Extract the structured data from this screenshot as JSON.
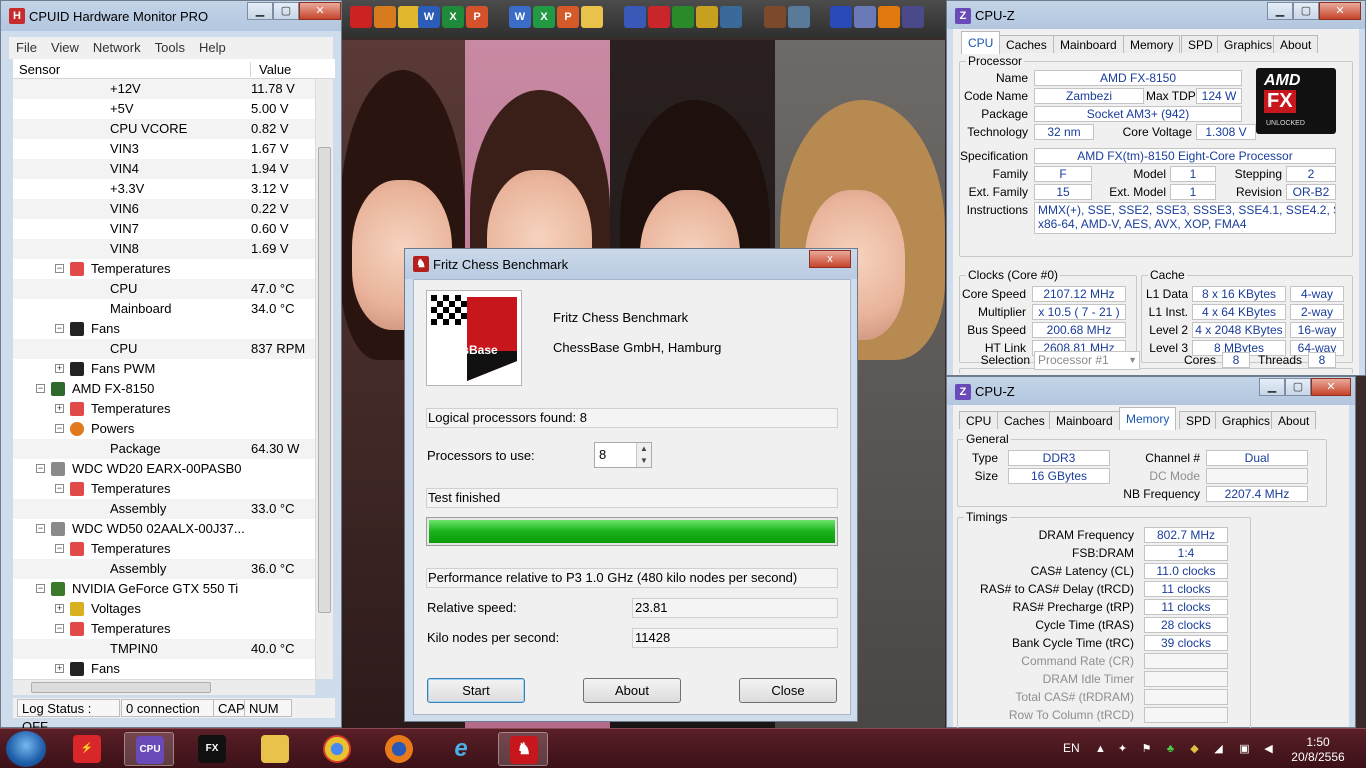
{
  "hwmonitor": {
    "title": "CPUID Hardware Monitor PRO",
    "menu": [
      "File",
      "View",
      "Network",
      "Tools",
      "Help"
    ],
    "columns": {
      "sensor": "Sensor",
      "value": "Value"
    },
    "rows": [
      {
        "label": "+12V",
        "value": "11.78 V"
      },
      {
        "label": "+5V",
        "value": "5.00 V"
      },
      {
        "label": "CPU VCORE",
        "value": "0.82 V"
      },
      {
        "label": "VIN3",
        "value": "1.67 V"
      },
      {
        "label": "VIN4",
        "value": "1.94 V"
      },
      {
        "label": "+3.3V",
        "value": "3.12 V"
      },
      {
        "label": "VIN6",
        "value": "0.22 V"
      },
      {
        "label": "VIN7",
        "value": "0.60 V"
      },
      {
        "label": "VIN8",
        "value": "1.69 V"
      },
      {
        "label": "Temperatures",
        "value": ""
      },
      {
        "label": "CPU",
        "value": "47.0 °C"
      },
      {
        "label": "Mainboard",
        "value": "34.0 °C"
      },
      {
        "label": "Fans",
        "value": ""
      },
      {
        "label": "CPU",
        "value": "837 RPM"
      },
      {
        "label": "Fans PWM",
        "value": ""
      },
      {
        "label": "AMD FX-8150",
        "value": ""
      },
      {
        "label": "Temperatures",
        "value": ""
      },
      {
        "label": "Powers",
        "value": ""
      },
      {
        "label": "Package",
        "value": "64.30 W"
      },
      {
        "label": "WDC WD20 EARX-00PASB0",
        "value": ""
      },
      {
        "label": "Temperatures",
        "value": ""
      },
      {
        "label": "Assembly",
        "value": "33.0 °C"
      },
      {
        "label": "WDC WD50 02AALX-00J37...",
        "value": ""
      },
      {
        "label": "Temperatures",
        "value": ""
      },
      {
        "label": "Assembly",
        "value": "36.0 °C"
      },
      {
        "label": "NVIDIA GeForce GTX 550 Ti",
        "value": ""
      },
      {
        "label": "Voltages",
        "value": ""
      },
      {
        "label": "Temperatures",
        "value": ""
      },
      {
        "label": "TMPIN0",
        "value": "40.0 °C"
      },
      {
        "label": "Fans",
        "value": ""
      }
    ],
    "status": {
      "log": "Log Status : OFF",
      "connection": "0 connection",
      "cap": "CAP",
      "num": "NUM"
    }
  },
  "fritz": {
    "title": "Fritz Chess Benchmark",
    "logo_text": "ChessBase",
    "app_name": "Fritz Chess Benchmark",
    "company": "ChessBase GmbH, Hamburg",
    "logical_processors": "Logical processors found: 8",
    "processors_label": "Processors to use:",
    "processors_value": "8",
    "status": "Test finished",
    "progress_percent": 100,
    "performance_note": "Performance relative to P3 1.0 GHz (480 kilo nodes per second)",
    "relative_speed_label": "Relative speed:",
    "relative_speed_value": "23.81",
    "knps_label": "Kilo nodes per second:",
    "knps_value": "11428",
    "buttons": {
      "start": "Start",
      "about": "About",
      "close": "Close"
    },
    "close_glyph": "x"
  },
  "cpuz_cpu": {
    "title": "CPU-Z",
    "tabs": [
      "CPU",
      "Caches",
      "Mainboard",
      "Memory",
      "SPD",
      "Graphics",
      "About"
    ],
    "processor_group": "Processor",
    "logo": {
      "brand": "AMD",
      "line": "FX",
      "tag": "UNLOCKED"
    },
    "name_label": "Name",
    "name": "AMD FX-8150",
    "codename_label": "Code Name",
    "codename": "Zambezi",
    "maxtdp_label": "Max TDP",
    "maxtdp": "124 W",
    "package_label": "Package",
    "package": "Socket AM3+ (942)",
    "technology_label": "Technology",
    "technology": "32 nm",
    "corevoltage_label": "Core Voltage",
    "corevoltage": "1.308 V",
    "spec_label": "Specification",
    "spec": "AMD FX(tm)-8150 Eight-Core Processor",
    "family_label": "Family",
    "family": "F",
    "model_label": "Model",
    "model": "1",
    "stepping_label": "Stepping",
    "stepping": "2",
    "extfamily_label": "Ext. Family",
    "extfamily": "15",
    "extmodel_label": "Ext. Model",
    "extmodel": "1",
    "revision_label": "Revision",
    "revision": "OR-B2",
    "instructions_label": "Instructions",
    "instructions_1": "MMX(+), SSE, SSE2, SSE3, SSSE3, SSE4.1, SSE4.2, SSE4A,",
    "instructions_2": "x86-64, AMD-V, AES, AVX, XOP, FMA4",
    "clocks_group": "Clocks (Core #0)",
    "corespeed_label": "Core Speed",
    "corespeed": "2107.12 MHz",
    "multiplier_label": "Multiplier",
    "multiplier": "x 10.5 ( 7 - 21 )",
    "busspeed_label": "Bus Speed",
    "busspeed": "200.68 MHz",
    "htlink_label": "HT Link",
    "htlink": "2608.81 MHz",
    "cache_group": "Cache",
    "l1data_label": "L1 Data",
    "l1data": "8 x 16 KBytes",
    "l1data_way": "4-way",
    "l1inst_label": "L1 Inst.",
    "l1inst": "4 x 64 KBytes",
    "l1inst_way": "2-way",
    "l2_label": "Level 2",
    "l2": "4 x 2048 KBytes",
    "l2_way": "16-way",
    "l3_label": "Level 3",
    "l3": "8 MBytes",
    "l3_way": "64-way",
    "selection_label": "Selection",
    "selection": "Processor #1",
    "cores_label": "Cores",
    "cores": "8",
    "threads_label": "Threads",
    "threads": "8"
  },
  "cpuz_mem": {
    "title": "CPU-Z",
    "tabs": [
      "CPU",
      "Caches",
      "Mainboard",
      "Memory",
      "SPD",
      "Graphics",
      "About"
    ],
    "general_group": "General",
    "type_label": "Type",
    "type": "DDR3",
    "size_label": "Size",
    "size": "16 GBytes",
    "channel_label": "Channel #",
    "channel": "Dual",
    "dcmode_label": "DC Mode",
    "nbfreq_label": "NB Frequency",
    "nbfreq": "2207.4 MHz",
    "timings_group": "Timings",
    "timings": [
      {
        "label": "DRAM Frequency",
        "value": "802.7 MHz",
        "dim": false
      },
      {
        "label": "FSB:DRAM",
        "value": "1:4",
        "dim": false
      },
      {
        "label": "CAS# Latency (CL)",
        "value": "11.0 clocks",
        "dim": false
      },
      {
        "label": "RAS# to CAS# Delay (tRCD)",
        "value": "11 clocks",
        "dim": false
      },
      {
        "label": "RAS# Precharge (tRP)",
        "value": "11 clocks",
        "dim": false
      },
      {
        "label": "Cycle Time (tRAS)",
        "value": "28 clocks",
        "dim": false
      },
      {
        "label": "Bank Cycle Time (tRC)",
        "value": "39 clocks",
        "dim": false
      },
      {
        "label": "Command Rate (CR)",
        "value": "",
        "dim": true
      },
      {
        "label": "DRAM Idle Timer",
        "value": "",
        "dim": true
      },
      {
        "label": "Total CAS# (tRDRAM)",
        "value": "",
        "dim": true
      },
      {
        "label": "Row To Column (tRCD)",
        "value": "",
        "dim": true
      }
    ]
  },
  "taskbar": {
    "language": "EN",
    "time": "1:50",
    "date": "20/8/2556"
  },
  "colors": {
    "taskbar": "#4a1820",
    "cpuz_value_text": "#1a3d9a",
    "progress_green": "#19b319",
    "amd_red": "#c8161d"
  }
}
